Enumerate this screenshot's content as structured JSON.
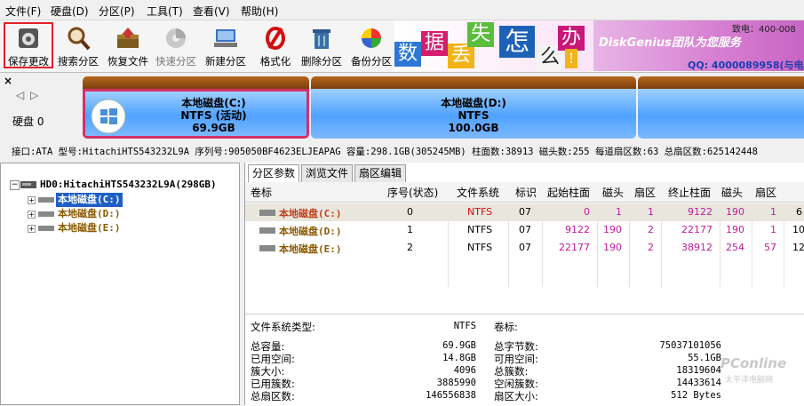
{
  "menu": [
    "文件(F)",
    "硬盘(D)",
    "分区(P)",
    "工具(T)",
    "查看(V)",
    "帮助(H)"
  ],
  "toolbar": [
    {
      "label": "保存更改",
      "icon": "save-icon"
    },
    {
      "label": "搜索分区",
      "icon": "magnifier-icon"
    },
    {
      "label": "恢复文件",
      "icon": "recover-icon"
    },
    {
      "label": "快速分区",
      "icon": "quick-partition-icon"
    },
    {
      "label": "新建分区",
      "icon": "new-partition-icon"
    },
    {
      "label": "格式化",
      "icon": "format-icon"
    },
    {
      "label": "删除分区",
      "icon": "delete-icon"
    },
    {
      "label": "备份分区",
      "icon": "backup-icon"
    }
  ],
  "banner": {
    "tiles": [
      "数",
      "据",
      "丢",
      "失",
      "怎",
      "么",
      "办",
      "!"
    ],
    "tagline": "DiskGenius团队为您服务",
    "tel": "致电：400-008",
    "qq": "QQ: 4000089958(与电"
  },
  "disk_bar": {
    "disk_label": "硬盘 0",
    "partitions": [
      {
        "name": "本地磁盘(C:)",
        "fs": "NTFS (活动)",
        "size": "69.9GB"
      },
      {
        "name": "本地磁盘(D:)",
        "fs": "NTFS",
        "size": "100.0GB"
      },
      {
        "name": "",
        "fs": "",
        "size": ""
      }
    ]
  },
  "info_line": "接口:ATA  型号:HitachiHTS543232L9A  序列号:905050BF4623ELJEAPAG  容量:298.1GB(305245MB)  柱面数:38913  磁头数:255  每道扇区数:63  总扇区数:625142448",
  "tree": {
    "root": "HD0:HitachiHTS543232L9A(298GB)",
    "items": [
      "本地磁盘(C:)",
      "本地磁盘(D:)",
      "本地磁盘(E:)"
    ]
  },
  "tabs": [
    "分区参数",
    "浏览文件",
    "扇区编辑"
  ],
  "table": {
    "headers": [
      "卷标",
      "序号(状态)",
      "文件系统",
      "标识",
      "起始柱面",
      "磁头",
      "扇区",
      "终止柱面",
      "磁头",
      "扇区"
    ],
    "rows": [
      [
        "本地磁盘(C:)",
        "0",
        "NTFS",
        "07",
        "0",
        "1",
        "1",
        "9122",
        "190",
        "1",
        "6"
      ],
      [
        "本地磁盘(D:)",
        "1",
        "NTFS",
        "07",
        "9122",
        "190",
        "2",
        "22177",
        "190",
        "1",
        "10"
      ],
      [
        "本地磁盘(E:)",
        "2",
        "NTFS",
        "07",
        "22177",
        "190",
        "2",
        "38912",
        "254",
        "57",
        "12"
      ]
    ]
  },
  "details": {
    "fs_type_label": "文件系统类型:",
    "fs_type": "NTFS",
    "volume_label": "卷标:",
    "left": [
      {
        "k": "总容量:",
        "v": "69.9GB"
      },
      {
        "k": "已用空间:",
        "v": "14.8GB"
      },
      {
        "k": "簇大小:",
        "v": "4096"
      },
      {
        "k": "已用簇数:",
        "v": "3885990"
      },
      {
        "k": "总扇区数:",
        "v": "146556838"
      }
    ],
    "right": [
      {
        "k": "总字节数:",
        "v": "75037101056"
      },
      {
        "k": "可用空间:",
        "v": "55.1GB"
      },
      {
        "k": "总簇数:",
        "v": "18319604"
      },
      {
        "k": "空闲簇数:",
        "v": "14433614"
      },
      {
        "k": "扇区大小:",
        "v": "512 Bytes"
      }
    ]
  },
  "watermark": "PConline",
  "watermark_sub": "太平洋电脑网",
  "colors": {
    "accent_red": "#e0202a",
    "partition_blue": "#4fa2ff",
    "partition_cap": "#9c5418",
    "label_brown": "#8b5a00"
  }
}
